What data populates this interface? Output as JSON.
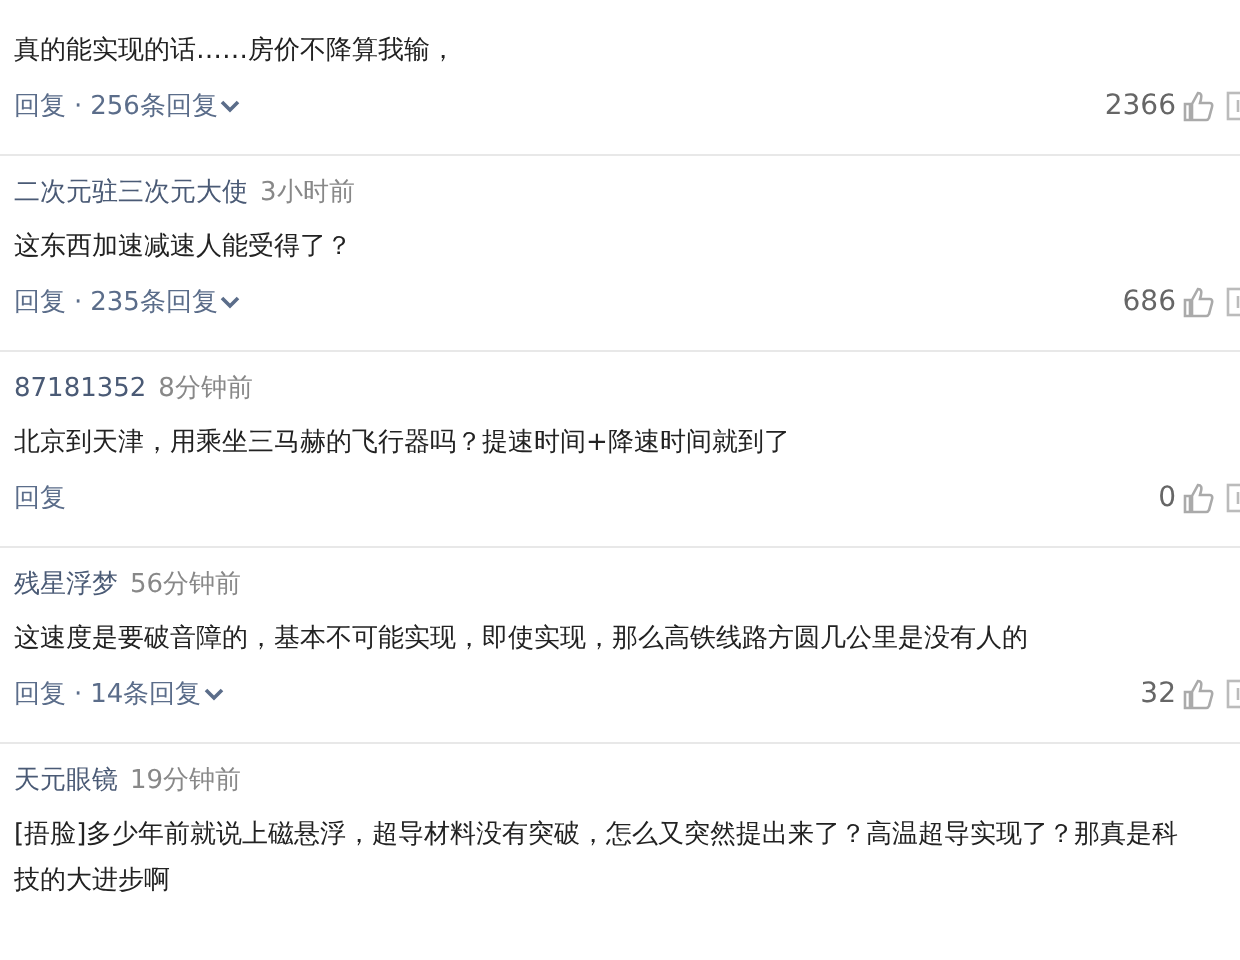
{
  "comments": [
    {
      "text": "真的能实现的话……房价不降算我输，",
      "reply": "回复",
      "separator": "·",
      "replies": "256条回复",
      "likes": "2366"
    },
    {
      "user": "二次元驻三次元大使",
      "time": "3小时前",
      "text": "这东西加速减速人能受得了？",
      "reply": "回复",
      "separator": "·",
      "replies": "235条回复",
      "likes": "686"
    },
    {
      "user": "87181352",
      "time": "8分钟前",
      "text": "北京到天津，用乘坐三马赫的飞行器吗？提速时间+降速时间就到了",
      "reply": "回复",
      "likes": "0"
    },
    {
      "user": "残星浮梦",
      "time": "56分钟前",
      "text": "这速度是要破音障的，基本不可能实现，即使实现，那么高铁线路方圆几公里是没有人的",
      "reply": "回复",
      "separator": "·",
      "replies": "14条回复",
      "likes": "32"
    },
    {
      "user": "天元眼镜",
      "time": "19分钟前",
      "text": "[捂脸]多少年前就说上磁悬浮，超导材料没有突破，怎么又突然提出来了？高温超导实现了？那真是科技的大进步啊"
    }
  ]
}
